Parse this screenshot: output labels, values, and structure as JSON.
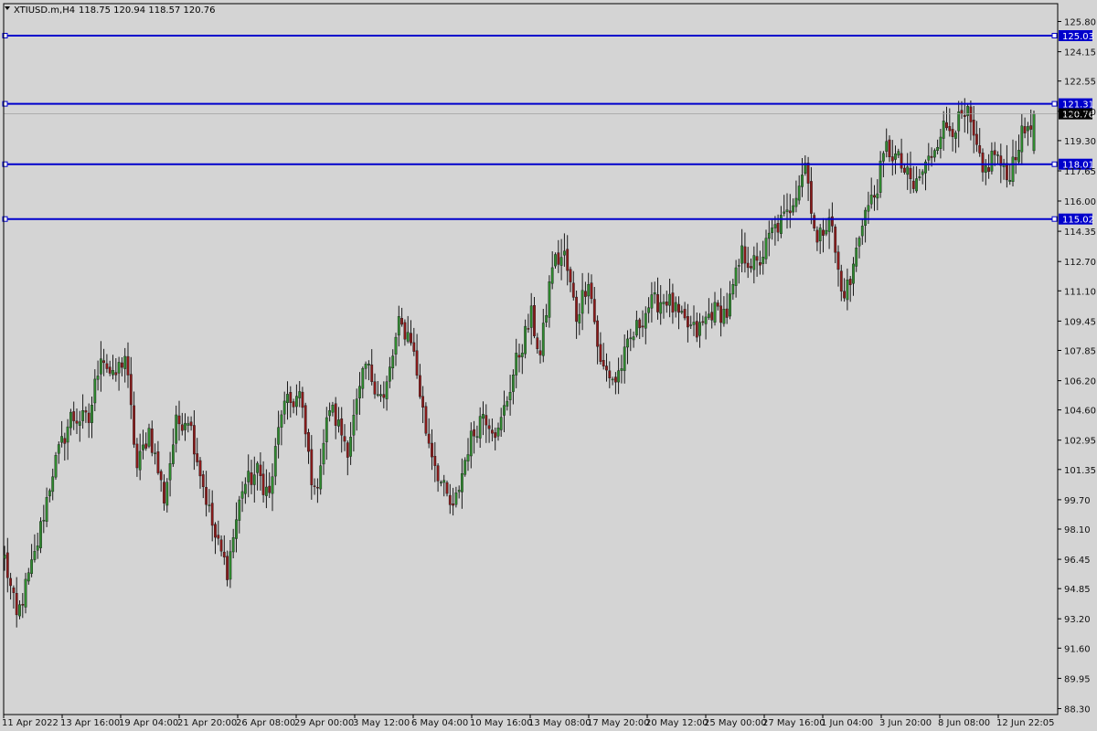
{
  "header": {
    "symbol_label": "XTIUSD.m,H4",
    "ohlc_text": "118.75 120.94 118.57 120.76"
  },
  "colors": {
    "background": "#d4d4d4",
    "axis": "#000000",
    "bull": "#2f8a2f",
    "bear": "#8b1a1a",
    "wick": "#1a1a1a",
    "level_line": "#0000cc",
    "level_label_bg": "#0000cc",
    "level_label_text": "#ffffff",
    "current_bg": "#000000",
    "current_text": "#ffffff"
  },
  "chart_data": {
    "type": "candlestick",
    "timeframe": "H4",
    "ylim": [
      88.3,
      126.2
    ],
    "yticks": [
      125.8,
      124.15,
      122.55,
      120.9,
      119.3,
      117.65,
      116.0,
      114.35,
      112.7,
      111.1,
      109.45,
      107.85,
      106.2,
      104.6,
      102.95,
      101.35,
      99.7,
      98.1,
      96.45,
      94.85,
      93.2,
      91.6,
      89.95,
      88.3
    ],
    "xticks": [
      "11 Apr 2022",
      "13 Apr 16:00",
      "19 Apr 04:00",
      "21 Apr 20:00",
      "26 Apr 08:00",
      "29 Apr 00:00",
      "3 May 12:00",
      "6 May 04:00",
      "10 May 16:00",
      "13 May 08:00",
      "17 May 20:00",
      "20 May 12:00",
      "25 May 00:00",
      "27 May 16:00",
      "1 Jun 04:00",
      "3 Jun 20:00",
      "8 Jun 08:00",
      "12 Jun 22:05"
    ],
    "levels": [
      125.03,
      121.31,
      118.01,
      115.02
    ],
    "current_price": 120.76,
    "waypoints": [
      [
        0,
        96.5
      ],
      [
        4,
        93.2
      ],
      [
        10,
        96.6
      ],
      [
        16,
        101.3
      ],
      [
        22,
        104.2
      ],
      [
        28,
        104.0
      ],
      [
        32,
        107.8
      ],
      [
        36,
        106.2
      ],
      [
        40,
        107.6
      ],
      [
        44,
        101.4
      ],
      [
        48,
        103.5
      ],
      [
        53,
        99.8
      ],
      [
        57,
        103.8
      ],
      [
        61,
        104.3
      ],
      [
        66,
        100.5
      ],
      [
        70,
        97.6
      ],
      [
        74,
        95.9
      ],
      [
        79,
        100.4
      ],
      [
        84,
        101.2
      ],
      [
        88,
        99.9
      ],
      [
        92,
        104.6
      ],
      [
        98,
        105.4
      ],
      [
        103,
        99.9
      ],
      [
        108,
        104.8
      ],
      [
        114,
        102.6
      ],
      [
        120,
        107.0
      ],
      [
        126,
        105.1
      ],
      [
        131,
        109.2
      ],
      [
        135,
        108.6
      ],
      [
        140,
        103.5
      ],
      [
        145,
        100.6
      ],
      [
        149,
        99.0
      ],
      [
        154,
        102.6
      ],
      [
        159,
        104.5
      ],
      [
        164,
        103.3
      ],
      [
        170,
        107.2
      ],
      [
        175,
        109.7
      ],
      [
        178,
        107.5
      ],
      [
        182,
        112.6
      ],
      [
        186,
        113.0
      ],
      [
        190,
        109.7
      ],
      [
        194,
        111.9
      ],
      [
        198,
        107.0
      ],
      [
        203,
        106.2
      ],
      [
        208,
        108.4
      ],
      [
        214,
        110.3
      ],
      [
        220,
        110.7
      ],
      [
        225,
        109.4
      ],
      [
        230,
        108.8
      ],
      [
        235,
        110.0
      ],
      [
        240,
        109.9
      ],
      [
        245,
        113.1
      ],
      [
        250,
        112.4
      ],
      [
        255,
        114.3
      ],
      [
        260,
        115.2
      ],
      [
        266,
        118.1
      ],
      [
        270,
        113.6
      ],
      [
        274,
        115.4
      ],
      [
        278,
        111.0
      ],
      [
        281,
        111.5
      ],
      [
        285,
        115.1
      ],
      [
        289,
        116.3
      ],
      [
        293,
        118.9
      ],
      [
        297,
        118.2
      ],
      [
        302,
        116.7
      ],
      [
        307,
        118.2
      ],
      [
        311,
        119.9
      ],
      [
        315,
        120.1
      ],
      [
        320,
        120.6
      ],
      [
        325,
        117.4
      ],
      [
        329,
        118.7
      ],
      [
        333,
        117.2
      ],
      [
        337,
        119.2
      ],
      [
        342,
        120.76
      ]
    ]
  }
}
